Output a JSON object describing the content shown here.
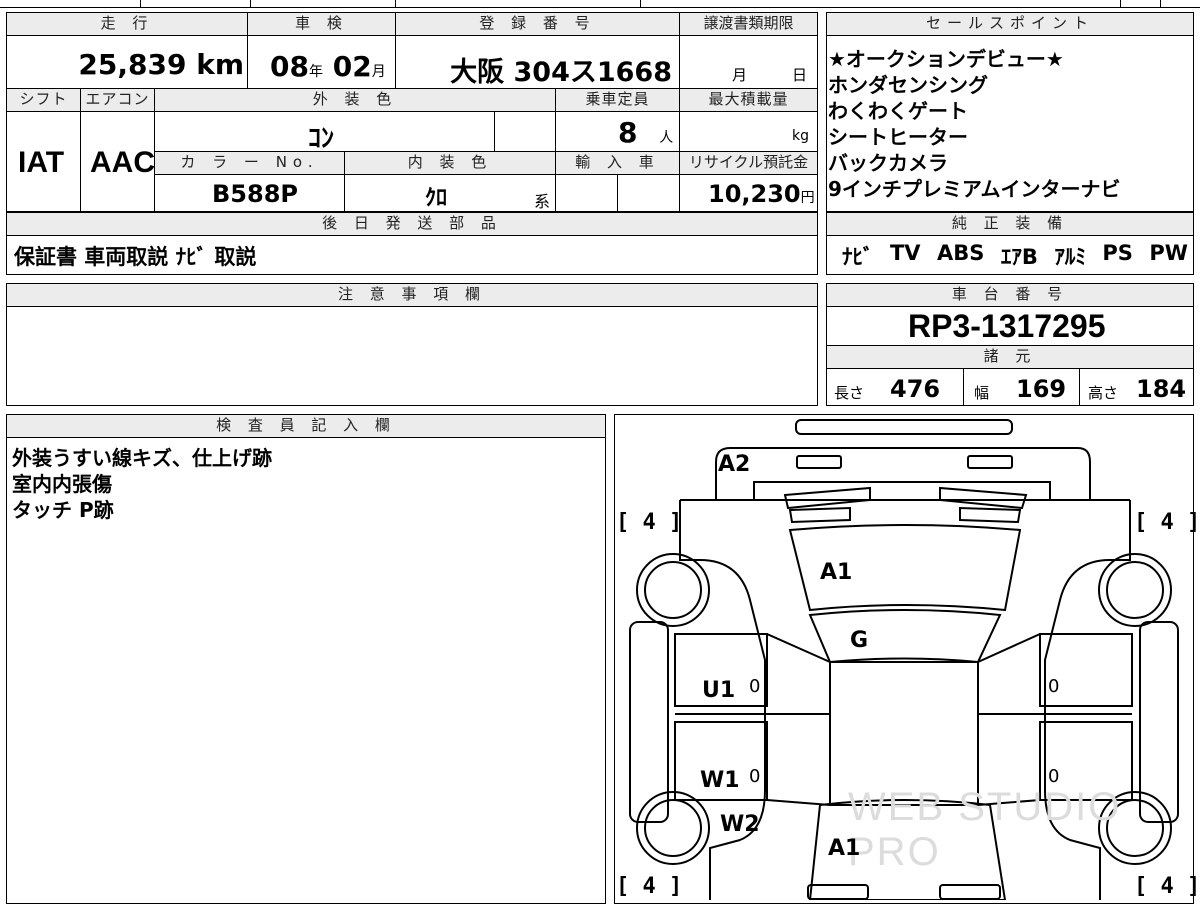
{
  "headers": {
    "mileage": "走 行",
    "inspection": "車 検",
    "registration": "登 録 番 号",
    "transfer_deadline": "譲渡書類期限",
    "sales_points": "セールスポイント",
    "shift": "シフト",
    "aircon": "エアコン",
    "exterior_color": "外 装 色",
    "capacity": "乗車定員",
    "max_load": "最大積載量",
    "color_no": "カ ラ ー No.",
    "interior_color": "内 装 色",
    "imported": "輸 入 車",
    "recycle_fee": "リサイクル預託金",
    "later_parts": "後 日 発 送 部 品",
    "genuine_equipment": "純 正 装 備",
    "notes": "注 意 事 項 欄",
    "chassis_number": "車 台 番 号",
    "specs": "諸 元",
    "inspector_notes": "検 査 員 記 入 欄"
  },
  "values": {
    "mileage": "25,839",
    "mileage_unit": "km",
    "inspection_year": "08",
    "inspection_year_unit": "年",
    "inspection_month": "02",
    "inspection_month_unit": "月",
    "registration": "大阪 304ス1668",
    "transfer_month_unit": "月",
    "transfer_day_unit": "日",
    "shift": "IAT",
    "aircon": "AAC",
    "exterior_color": "ｺﾝ",
    "capacity": "8",
    "capacity_unit": "人",
    "max_load_unit": "kg",
    "color_no": "B588P",
    "interior_color": "ｸﾛ",
    "interior_suffix": "系",
    "recycle_fee": "10,230",
    "recycle_unit": "円",
    "later_parts": "保証書 車両取説 ﾅﾋﾞ 取説",
    "chassis_number": "RP3-1317295",
    "length_label": "長さ",
    "length": "476",
    "width_label": "幅",
    "width": "169",
    "height_label": "高さ",
    "height": "184"
  },
  "sales_points": [
    "★オークションデビュー★",
    "ホンダセンシング",
    "わくわくゲート",
    "シートヒーター",
    "バックカメラ",
    "9インチプレミアムインターナビ"
  ],
  "equipment": [
    "ﾅﾋﾞ",
    "TV",
    "ABS",
    "ｴｱB",
    "ｱﾙﾐ",
    "PS",
    "PW"
  ],
  "inspector_lines": [
    "外装うすい線キズ、仕上げ跡",
    "室内内張傷",
    "タッチ P跡"
  ],
  "diagram": {
    "A2": "A2",
    "A1_front": "A1",
    "G": "G",
    "U1": "U1",
    "W1": "W1",
    "W2": "W2",
    "A1_rear": "A1",
    "tl": "[ 4 ]",
    "tr": "[ 4 ]",
    "bl": "[ 4 ]",
    "br": "[ 4 ]",
    "zero_l1": "0",
    "zero_l2": "0",
    "zero_r1": "0",
    "zero_r2": "0",
    "watermark": "WEB STUDIO PRO"
  }
}
